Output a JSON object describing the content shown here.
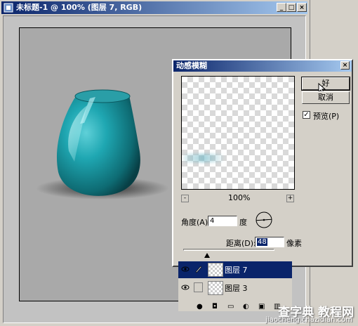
{
  "document": {
    "title": "未标题-1 @ 100% (图层 7, RGB)",
    "buttons": {
      "minimize": "_",
      "maximize": "□",
      "close": "×"
    }
  },
  "dialog": {
    "title": "动感模糊",
    "close": "×",
    "zoom": {
      "minus": "-",
      "value": "100%",
      "plus": "+"
    },
    "ok_label": "好",
    "cancel_label": "取消",
    "preview": {
      "label": "预览(P)",
      "checked": true,
      "check_mark": "✓"
    },
    "angle": {
      "label": "角度(A):",
      "value": "4",
      "unit": "度"
    },
    "distance": {
      "label": "距离(D):",
      "value": "48",
      "unit": "像素"
    }
  },
  "layers": {
    "items": [
      {
        "name": "图层 7",
        "selected": true
      },
      {
        "name": "图层 3",
        "selected": false
      }
    ],
    "toolbar_icons": [
      "layer-style-icon",
      "mask-icon",
      "layer-set-icon",
      "adjustment-icon",
      "new-layer-icon",
      "trash-icon"
    ]
  },
  "watermark": {
    "line1": "查字典 教程网",
    "line2": "jiaocheng.chazidian.com"
  },
  "colors": {
    "titlebar_start": "#0a246a",
    "titlebar_end": "#a6caf0",
    "vase": "#1e8a93",
    "selection": "#0a246a"
  }
}
